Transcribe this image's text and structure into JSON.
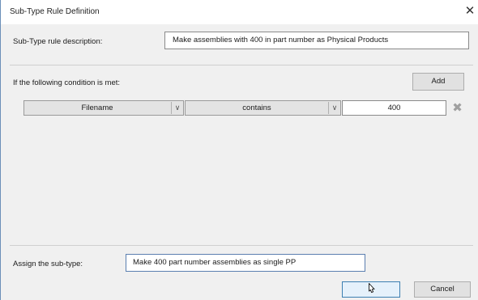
{
  "window": {
    "title": "Sub-Type Rule Definition",
    "close_glyph": "✕"
  },
  "description": {
    "label": "Sub-Type rule description:",
    "value": "Make assemblies with 400 in part number as Physical Products"
  },
  "condition": {
    "label": "If the following condition is met:",
    "add_label": "Add",
    "rows": [
      {
        "property": "Filename",
        "operator": "contains",
        "value": "400",
        "dropdown_glyph": "∨",
        "delete_glyph": "✖"
      }
    ]
  },
  "assign": {
    "label": "Assign the sub-type:",
    "value": "Make 400 part number assemblies as single PP"
  },
  "buttons": {
    "ok_label": "",
    "cancel_label": "Cancel"
  }
}
